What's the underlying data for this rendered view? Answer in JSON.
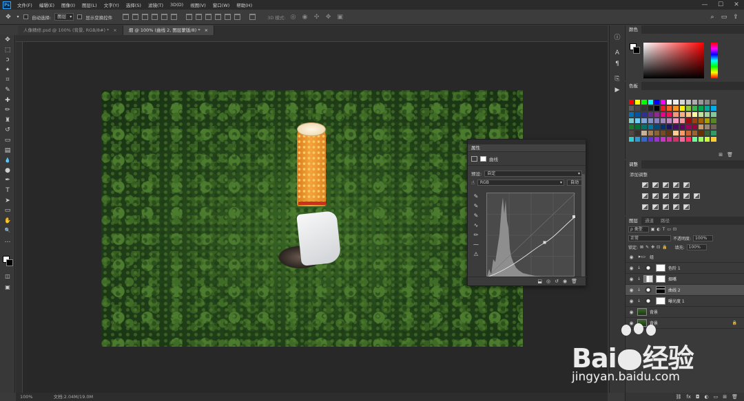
{
  "menubar": {
    "app_icon": "Ps",
    "items": [
      "文件(F)",
      "编辑(E)",
      "图像(I)",
      "图层(L)",
      "文字(Y)",
      "选择(S)",
      "滤镜(T)",
      "3D(D)",
      "视图(V)",
      "窗口(W)",
      "帮助(H)"
    ],
    "window_controls": [
      "—",
      "☐",
      "✕"
    ]
  },
  "options": {
    "auto_select_label": "自动选择:",
    "auto_select_value": "图层",
    "show_transform_label": "显示变换控件",
    "mode_3d_label": "3D 模式:"
  },
  "tabs": [
    {
      "label": "人像精修.psd @ 100% (背景, RGB/8#) *",
      "close": "×"
    },
    {
      "label": "烟 @ 100% (曲线 2, 图层蒙版/8) *",
      "close": "×"
    }
  ],
  "tools": [
    "move-icon",
    "marquee-icon",
    "lasso-icon",
    "magic-wand-icon",
    "crop-icon",
    "eyedropper-icon",
    "healing-icon",
    "brush-icon",
    "stamp-icon",
    "history-brush-icon",
    "eraser-icon",
    "gradient-icon",
    "blur-icon",
    "dodge-icon",
    "pen-icon",
    "type-icon",
    "path-select-icon",
    "shape-icon",
    "hand-icon",
    "zoom-icon"
  ],
  "tool_glyphs": [
    "✥",
    "⬚",
    "ↄ",
    "✦",
    "⌗",
    "✎",
    "✚",
    "✏",
    "♜",
    "↺",
    "▭",
    "▤",
    "💧",
    "●",
    "✒",
    "T",
    "➤",
    "▭",
    "✋",
    "🔍",
    "…"
  ],
  "properties": {
    "title": "属性",
    "subtitle": "曲线",
    "preset_label": "预设:",
    "preset_value": "自定",
    "channel_value": "RGB",
    "auto_button": "自动"
  },
  "panels": {
    "color_tab": "颜色",
    "swatches_tab": "色板",
    "adjust_tab": "调整",
    "adjust_title": "添加调整",
    "layers_tabs": [
      "图层",
      "通道",
      "路径"
    ],
    "kind_value": "ρ 类型",
    "blend_mode": "正常",
    "opacity_label": "不透明度:",
    "opacity_value": "100%",
    "lock_label": "锁定:",
    "fill_label": "填充:",
    "fill_value": "100%"
  },
  "layers": [
    {
      "name": "组",
      "thumb": "folder",
      "mask": false,
      "selected": false
    },
    {
      "name": "色阶 1",
      "thumb": "adj",
      "mask": "white",
      "selected": false
    },
    {
      "name": "烟嘴",
      "thumb": "cig",
      "mask": "white",
      "selected": false
    },
    {
      "name": "曲线 2",
      "thumb": "adj",
      "mask": "dark",
      "selected": true
    },
    {
      "name": "曝光度 1",
      "thumb": "adj",
      "mask": "white",
      "selected": false
    },
    {
      "name": "背景",
      "thumb": "photo",
      "mask": false,
      "selected": false
    },
    {
      "name": "背景",
      "thumb": "photo",
      "mask": false,
      "selected": false
    }
  ],
  "status": {
    "zoom": "100%",
    "doc": "文档:2.04M/19.0M"
  },
  "watermark": {
    "brand": "Bai",
    "brand_suffix": "经验",
    "url": "jingyan.baidu.com"
  },
  "colors": {
    "accent": "#31a8ff",
    "forest": "#2f5a22",
    "filter_orange": "#f4a43c",
    "band_red": "#c9301f"
  }
}
